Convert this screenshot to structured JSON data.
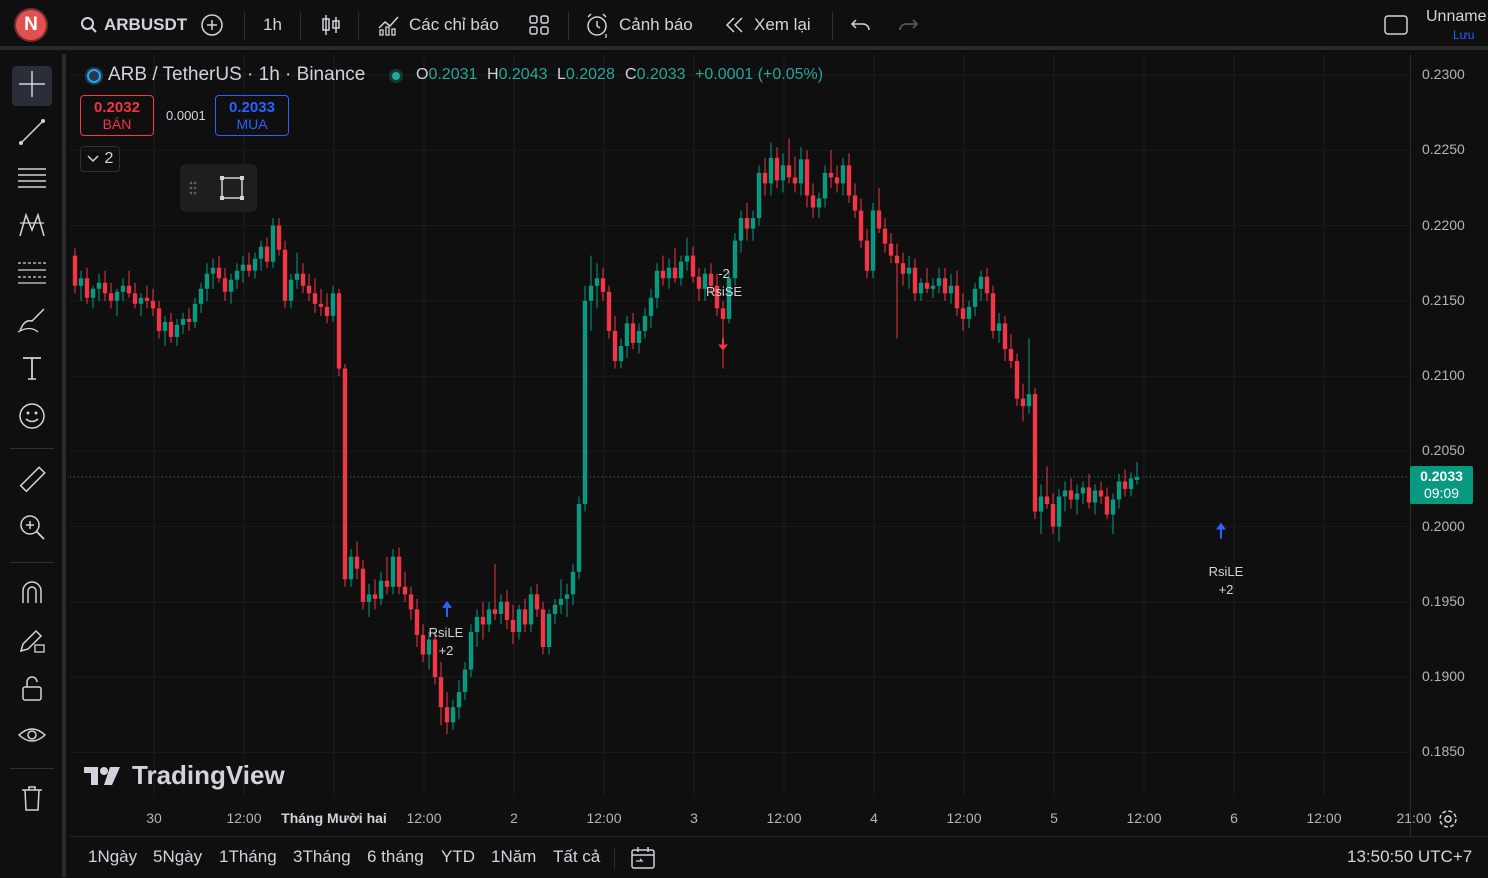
{
  "topbar": {
    "avatar_letter": "N",
    "symbol": "ARBUSDT",
    "interval": "1h",
    "indicators_label": "Các chỉ báo",
    "alerts_label": "Cảnh báo",
    "replay_label": "Xem lại",
    "layout_name": "Unname",
    "save_label": "Lưu"
  },
  "legend": {
    "title": "ARB / TetherUS · 1h · Binance",
    "o_key": "O",
    "o_val": "0.2031",
    "h_key": "H",
    "h_val": "0.2043",
    "l_key": "L",
    "l_val": "0.2028",
    "c_key": "C",
    "c_val": "0.2033",
    "change": "+0.0001 (+0.05%)",
    "sell_price": "0.2032",
    "sell_label": "BÁN",
    "spread": "0.0001",
    "buy_price": "0.2033",
    "buy_label": "MUA",
    "collapse_count": "2"
  },
  "price_axis": {
    "ticks": [
      "0.2300",
      "0.2250",
      "0.2200",
      "0.2150",
      "0.2100",
      "0.2050",
      "0.2000",
      "0.1950",
      "0.1900",
      "0.1850"
    ],
    "last_price": "0.2033",
    "countdown": "09:09"
  },
  "time_axis": {
    "ticks": [
      "30",
      "12:00",
      "Tháng Mười hai",
      "12:00",
      "2",
      "12:00",
      "3",
      "12:00",
      "4",
      "12:00",
      "5",
      "12:00",
      "6",
      "12:00",
      "21:00"
    ]
  },
  "signals": [
    {
      "label": "RsiLE",
      "qty": "+2"
    },
    {
      "label": "RsiSE",
      "qty": "-2"
    },
    {
      "label": "RsiLE",
      "qty": "+2"
    }
  ],
  "watermark": "TradingView",
  "bottombar": {
    "ranges": [
      "1Ngày",
      "5Ngày",
      "1Tháng",
      "3Tháng",
      "6 tháng",
      "YTD",
      "1Năm",
      "Tất cả"
    ],
    "clock": "13:50:50 UTC+7"
  },
  "colors": {
    "up": "#089981",
    "down": "#f23645",
    "background": "#0f0f0f",
    "buy_accent": "#2962ff"
  },
  "chart_data": {
    "type": "candlestick",
    "title": "ARB / TetherUS · 1h · Binance",
    "ylim": [
      0.1825,
      0.231
    ],
    "candles": [
      [
        0.218,
        0.2185,
        0.2155,
        0.216
      ],
      [
        0.216,
        0.217,
        0.215,
        0.2165
      ],
      [
        0.2165,
        0.2172,
        0.2148,
        0.2152
      ],
      [
        0.2152,
        0.216,
        0.2145,
        0.2158
      ],
      [
        0.2158,
        0.2168,
        0.215,
        0.2162
      ],
      [
        0.2162,
        0.217,
        0.215,
        0.2155
      ],
      [
        0.2155,
        0.2162,
        0.2145,
        0.215
      ],
      [
        0.215,
        0.2158,
        0.214,
        0.2156
      ],
      [
        0.2156,
        0.2165,
        0.215,
        0.216
      ],
      [
        0.216,
        0.217,
        0.2152,
        0.2155
      ],
      [
        0.2155,
        0.2162,
        0.2145,
        0.2148
      ],
      [
        0.2148,
        0.2155,
        0.214,
        0.2152
      ],
      [
        0.2152,
        0.216,
        0.2145,
        0.215
      ],
      [
        0.215,
        0.2158,
        0.214,
        0.2145
      ],
      [
        0.2145,
        0.215,
        0.2125,
        0.213
      ],
      [
        0.213,
        0.214,
        0.212,
        0.2136
      ],
      [
        0.2136,
        0.2142,
        0.2122,
        0.2126
      ],
      [
        0.2126,
        0.2138,
        0.212,
        0.2134
      ],
      [
        0.2134,
        0.2142,
        0.2128,
        0.2138
      ],
      [
        0.2138,
        0.2145,
        0.213,
        0.2136
      ],
      [
        0.2136,
        0.2152,
        0.2132,
        0.2148
      ],
      [
        0.2148,
        0.2162,
        0.2142,
        0.2158
      ],
      [
        0.2158,
        0.2175,
        0.215,
        0.2168
      ],
      [
        0.2168,
        0.2178,
        0.2158,
        0.2172
      ],
      [
        0.2172,
        0.218,
        0.2162,
        0.2165
      ],
      [
        0.2165,
        0.2172,
        0.215,
        0.2156
      ],
      [
        0.2156,
        0.2168,
        0.2148,
        0.2164
      ],
      [
        0.2164,
        0.2175,
        0.2158,
        0.217
      ],
      [
        0.217,
        0.218,
        0.2162,
        0.2174
      ],
      [
        0.2174,
        0.2182,
        0.2166,
        0.217
      ],
      [
        0.217,
        0.2182,
        0.2165,
        0.2178
      ],
      [
        0.2178,
        0.219,
        0.217,
        0.2186
      ],
      [
        0.2186,
        0.2192,
        0.2172,
        0.2176
      ],
      [
        0.2176,
        0.2205,
        0.2172,
        0.22
      ],
      [
        0.22,
        0.2205,
        0.218,
        0.2184
      ],
      [
        0.2184,
        0.219,
        0.2145,
        0.215
      ],
      [
        0.215,
        0.2168,
        0.2145,
        0.2164
      ],
      [
        0.2164,
        0.2182,
        0.2158,
        0.2168
      ],
      [
        0.2168,
        0.2175,
        0.2155,
        0.216
      ],
      [
        0.216,
        0.2168,
        0.215,
        0.2155
      ],
      [
        0.2155,
        0.2165,
        0.2142,
        0.2148
      ],
      [
        0.2148,
        0.2158,
        0.214,
        0.2146
      ],
      [
        0.2146,
        0.2155,
        0.2135,
        0.214
      ],
      [
        0.214,
        0.216,
        0.2136,
        0.2155
      ],
      [
        0.2155,
        0.2158,
        0.21,
        0.2105
      ],
      [
        0.2105,
        0.2108,
        0.196,
        0.1965
      ],
      [
        0.1965,
        0.1985,
        0.196,
        0.198
      ],
      [
        0.198,
        0.199,
        0.1965,
        0.1972
      ],
      [
        0.1972,
        0.1978,
        0.1945,
        0.195
      ],
      [
        0.195,
        0.1962,
        0.194,
        0.1955
      ],
      [
        0.1955,
        0.1965,
        0.1945,
        0.1952
      ],
      [
        0.1952,
        0.197,
        0.1948,
        0.1964
      ],
      [
        0.1964,
        0.198,
        0.1955,
        0.196
      ],
      [
        0.196,
        0.1985,
        0.1955,
        0.198
      ],
      [
        0.198,
        0.1986,
        0.1955,
        0.196
      ],
      [
        0.196,
        0.197,
        0.195,
        0.1955
      ],
      [
        0.1955,
        0.196,
        0.1938,
        0.1945
      ],
      [
        0.1945,
        0.1952,
        0.192,
        0.1928
      ],
      [
        0.1928,
        0.1935,
        0.191,
        0.1915
      ],
      [
        0.1915,
        0.193,
        0.1905,
        0.1925
      ],
      [
        0.1925,
        0.193,
        0.1895,
        0.19
      ],
      [
        0.19,
        0.191,
        0.1868,
        0.188
      ],
      [
        0.188,
        0.189,
        0.1862,
        0.187
      ],
      [
        0.187,
        0.1885,
        0.1865,
        0.188
      ],
      [
        0.188,
        0.1898,
        0.1872,
        0.189
      ],
      [
        0.189,
        0.191,
        0.1885,
        0.1905
      ],
      [
        0.1905,
        0.1935,
        0.19,
        0.193
      ],
      [
        0.193,
        0.1945,
        0.192,
        0.194
      ],
      [
        0.194,
        0.195,
        0.1925,
        0.1935
      ],
      [
        0.1935,
        0.195,
        0.193,
        0.1945
      ],
      [
        0.1945,
        0.1975,
        0.1938,
        0.1942
      ],
      [
        0.1942,
        0.1955,
        0.1935,
        0.195
      ],
      [
        0.195,
        0.1958,
        0.1932,
        0.1938
      ],
      [
        0.1938,
        0.1948,
        0.1922,
        0.193
      ],
      [
        0.193,
        0.1948,
        0.1925,
        0.1945
      ],
      [
        0.1945,
        0.1952,
        0.193,
        0.1935
      ],
      [
        0.1935,
        0.196,
        0.193,
        0.1955
      ],
      [
        0.1955,
        0.1962,
        0.194,
        0.1945
      ],
      [
        0.1945,
        0.195,
        0.1915,
        0.192
      ],
      [
        0.192,
        0.1945,
        0.1915,
        0.1942
      ],
      [
        0.1942,
        0.1952,
        0.1935,
        0.1948
      ],
      [
        0.1948,
        0.1965,
        0.1942,
        0.1952
      ],
      [
        0.1952,
        0.1962,
        0.194,
        0.1955
      ],
      [
        0.1955,
        0.1975,
        0.1948,
        0.197
      ],
      [
        0.197,
        0.202,
        0.1965,
        0.2015
      ],
      [
        0.2015,
        0.216,
        0.201,
        0.215
      ],
      [
        0.215,
        0.218,
        0.213,
        0.216
      ],
      [
        0.216,
        0.2175,
        0.2145,
        0.2165
      ],
      [
        0.2165,
        0.2172,
        0.215,
        0.2156
      ],
      [
        0.2156,
        0.216,
        0.2125,
        0.213
      ],
      [
        0.213,
        0.214,
        0.2105,
        0.211
      ],
      [
        0.211,
        0.2125,
        0.2105,
        0.212
      ],
      [
        0.212,
        0.214,
        0.2112,
        0.2135
      ],
      [
        0.2135,
        0.2142,
        0.2118,
        0.2122
      ],
      [
        0.2122,
        0.2135,
        0.2115,
        0.213
      ],
      [
        0.213,
        0.2145,
        0.2125,
        0.214
      ],
      [
        0.214,
        0.2158,
        0.2132,
        0.2152
      ],
      [
        0.2152,
        0.2175,
        0.2145,
        0.217
      ],
      [
        0.217,
        0.218,
        0.216,
        0.2165
      ],
      [
        0.2165,
        0.2178,
        0.2158,
        0.2172
      ],
      [
        0.2172,
        0.2185,
        0.2162,
        0.2165
      ],
      [
        0.2165,
        0.218,
        0.216,
        0.2176
      ],
      [
        0.2176,
        0.2192,
        0.217,
        0.218
      ],
      [
        0.218,
        0.2186,
        0.2162,
        0.2166
      ],
      [
        0.2166,
        0.2172,
        0.215,
        0.2158
      ],
      [
        0.2158,
        0.2172,
        0.215,
        0.2168
      ],
      [
        0.2168,
        0.2175,
        0.2155,
        0.216
      ],
      [
        0.216,
        0.2168,
        0.214,
        0.2145
      ],
      [
        0.2145,
        0.215,
        0.2105,
        0.2138
      ],
      [
        0.2138,
        0.217,
        0.2135,
        0.2165
      ],
      [
        0.2165,
        0.2195,
        0.216,
        0.219
      ],
      [
        0.219,
        0.221,
        0.2182,
        0.2205
      ],
      [
        0.2205,
        0.2215,
        0.219,
        0.2198
      ],
      [
        0.2198,
        0.221,
        0.219,
        0.2205
      ],
      [
        0.2205,
        0.224,
        0.22,
        0.2235
      ],
      [
        0.2235,
        0.2245,
        0.222,
        0.2228
      ],
      [
        0.2228,
        0.2255,
        0.222,
        0.2245
      ],
      [
        0.2245,
        0.2252,
        0.2225,
        0.223
      ],
      [
        0.223,
        0.2248,
        0.2222,
        0.224
      ],
      [
        0.224,
        0.2258,
        0.2228,
        0.2232
      ],
      [
        0.2232,
        0.2246,
        0.2222,
        0.2228
      ],
      [
        0.2228,
        0.2252,
        0.222,
        0.2244
      ],
      [
        0.2244,
        0.225,
        0.2212,
        0.222
      ],
      [
        0.222,
        0.2228,
        0.2205,
        0.2212
      ],
      [
        0.2212,
        0.2222,
        0.2205,
        0.2218
      ],
      [
        0.2218,
        0.224,
        0.2212,
        0.2235
      ],
      [
        0.2235,
        0.225,
        0.2225,
        0.2232
      ],
      [
        0.2232,
        0.224,
        0.2222,
        0.2228
      ],
      [
        0.2228,
        0.2245,
        0.222,
        0.224
      ],
      [
        0.224,
        0.2248,
        0.2215,
        0.222
      ],
      [
        0.222,
        0.2228,
        0.2205,
        0.221
      ],
      [
        0.221,
        0.2218,
        0.2185,
        0.219
      ],
      [
        0.219,
        0.2198,
        0.2165,
        0.217
      ],
      [
        0.217,
        0.2215,
        0.2165,
        0.221
      ],
      [
        0.221,
        0.2225,
        0.2195,
        0.2198
      ],
      [
        0.2198,
        0.2205,
        0.2182,
        0.2188
      ],
      [
        0.2188,
        0.2195,
        0.2175,
        0.218
      ],
      [
        0.218,
        0.2188,
        0.2125,
        0.2175
      ],
      [
        0.2175,
        0.2182,
        0.216,
        0.2168
      ],
      [
        0.2168,
        0.218,
        0.2158,
        0.2172
      ],
      [
        0.2172,
        0.2178,
        0.215,
        0.2155
      ],
      [
        0.2155,
        0.2165,
        0.215,
        0.2162
      ],
      [
        0.2162,
        0.2172,
        0.2155,
        0.2158
      ],
      [
        0.2158,
        0.2165,
        0.2152,
        0.216
      ],
      [
        0.216,
        0.2172,
        0.2155,
        0.2165
      ],
      [
        0.2165,
        0.2172,
        0.215,
        0.2155
      ],
      [
        0.2155,
        0.2168,
        0.2148,
        0.216
      ],
      [
        0.216,
        0.217,
        0.214,
        0.2145
      ],
      [
        0.2145,
        0.2155,
        0.213,
        0.2138
      ],
      [
        0.2138,
        0.215,
        0.2132,
        0.2146
      ],
      [
        0.2146,
        0.2162,
        0.214,
        0.2158
      ],
      [
        0.2158,
        0.217,
        0.215,
        0.2166
      ],
      [
        0.2166,
        0.2172,
        0.215,
        0.2155
      ],
      [
        0.2155,
        0.216,
        0.2125,
        0.213
      ],
      [
        0.213,
        0.2142,
        0.2122,
        0.2135
      ],
      [
        0.2135,
        0.214,
        0.211,
        0.2118
      ],
      [
        0.2118,
        0.2128,
        0.2105,
        0.211
      ],
      [
        0.211,
        0.2115,
        0.208,
        0.2085
      ],
      [
        0.2085,
        0.2095,
        0.207,
        0.208
      ],
      [
        0.208,
        0.2125,
        0.2075,
        0.2088
      ],
      [
        0.2088,
        0.2092,
        0.2005,
        0.201
      ],
      [
        0.201,
        0.2028,
        0.1995,
        0.202
      ],
      [
        0.202,
        0.204,
        0.2012,
        0.2015
      ],
      [
        0.2015,
        0.2022,
        0.1995,
        0.2
      ],
      [
        0.2,
        0.2025,
        0.199,
        0.202
      ],
      [
        0.202,
        0.203,
        0.201,
        0.2024
      ],
      [
        0.2024,
        0.2032,
        0.2012,
        0.2018
      ],
      [
        0.2018,
        0.2028,
        0.2008,
        0.2022
      ],
      [
        0.2022,
        0.203,
        0.2015,
        0.2026
      ],
      [
        0.2026,
        0.2035,
        0.2012,
        0.2016
      ],
      [
        0.2016,
        0.2028,
        0.2008,
        0.2024
      ],
      [
        0.2024,
        0.203,
        0.2015,
        0.202
      ],
      [
        0.202,
        0.2026,
        0.2005,
        0.2008
      ],
      [
        0.2008,
        0.2022,
        0.1995,
        0.2018
      ],
      [
        0.2018,
        0.2035,
        0.2012,
        0.203
      ],
      [
        0.203,
        0.2038,
        0.202,
        0.2025
      ],
      [
        0.2025,
        0.2036,
        0.202,
        0.2032
      ],
      [
        0.2031,
        0.2043,
        0.2028,
        0.2033
      ]
    ]
  }
}
